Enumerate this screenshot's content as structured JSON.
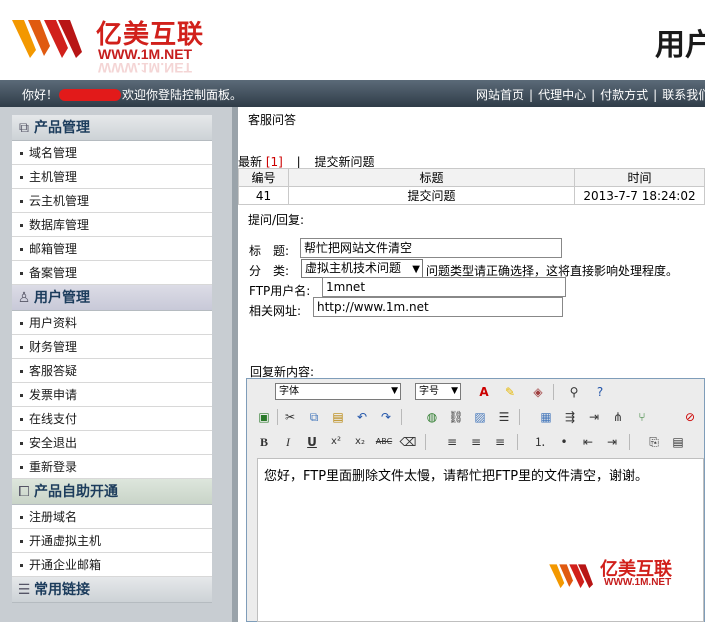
{
  "brand": {
    "name_cn": "亿美互联",
    "name_en": "WWW.1M.NET",
    "colors": {
      "red": "#d1201b",
      "orange": "#f39800"
    }
  },
  "header": {
    "title": "用户"
  },
  "topbar": {
    "greeting_prefix": "你好！",
    "greeting_suffix": "欢迎你登陆控制面板。",
    "links": [
      "网站首页",
      "代理中心",
      "付款方式",
      "联系我们"
    ],
    "separator": "|"
  },
  "sidebar": {
    "sections": [
      {
        "title": "产品管理",
        "icon": "product-icon",
        "items": [
          "域名管理",
          "主机管理",
          "云主机管理",
          "数据库管理",
          "邮箱管理",
          "备案管理"
        ]
      },
      {
        "title": "用户管理",
        "icon": "user-icon",
        "items": [
          "用户资料",
          "财务管理",
          "客服答疑",
          "发票申请",
          "在线支付",
          "安全退出",
          "重新登录"
        ]
      },
      {
        "title": "产品自助开通",
        "icon": "self-service-icon",
        "items": [
          "注册域名",
          "开通虚拟主机",
          "开通企业邮箱"
        ]
      },
      {
        "title": "常用链接",
        "icon": "list-icon",
        "items": []
      }
    ]
  },
  "content": {
    "page_title": "客服问答",
    "tabs": {
      "latest_label": "最新",
      "latest_count": "[1]",
      "sep": "|",
      "submit_label": "提交新问题"
    },
    "table": {
      "headers": [
        "编号",
        "标题",
        "时间"
      ],
      "rows": [
        {
          "id": "41",
          "title": "提交问题",
          "time": "2013-7-7 18:24:02"
        }
      ]
    },
    "reply_heading": "提问/回复:",
    "form": {
      "title_label": "标　题:",
      "title_value": "帮忙把网站文件清空",
      "category_label": "分　类:",
      "category_value": "虚拟主机技术问题",
      "category_hint": "问题类型请正确选择，这将直接影响处理程度。",
      "ftp_label": "FTP用户名:",
      "ftp_value": "1mnet",
      "url_label": "相关网址:",
      "url_value": "http://www.1m.net"
    },
    "reply_label": "回复新内容:",
    "editor": {
      "font_select": "字体",
      "size_select": "字号",
      "body_text": "您好，FTP里面删除文件太慢，请帮忙把FTP里的文件清空，谢谢。"
    }
  }
}
